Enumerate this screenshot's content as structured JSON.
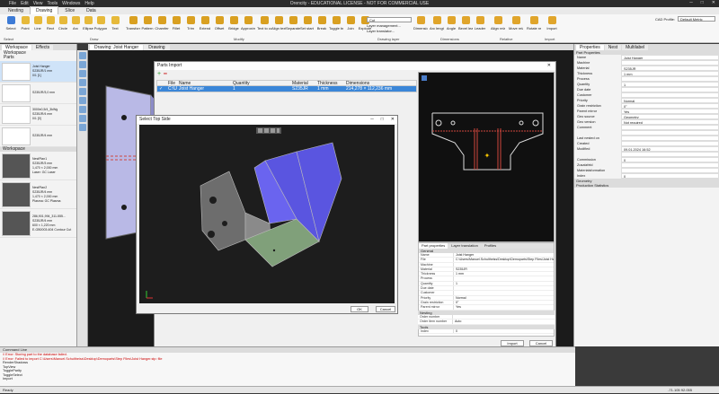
{
  "titlebar": {
    "title": "Orencity - EDUCATIONAL LICENSE - NOT FOR COMMERCIAL USE",
    "menu": [
      "File",
      "Edit",
      "View",
      "Tools",
      "Windows",
      "Help"
    ]
  },
  "ribbon_tabs": [
    "Nesting",
    "Drawing",
    "Slice",
    "Data"
  ],
  "ribbon": {
    "buttons": [
      {
        "label": "Select",
        "color": "#3d7bd6"
      },
      {
        "label": "Point",
        "color": "#e6b93a"
      },
      {
        "label": "Line",
        "color": "#e6b93a"
      },
      {
        "label": "Rect",
        "color": "#e6b93a"
      },
      {
        "label": "Circle",
        "color": "#e6b93a"
      },
      {
        "label": "Arc",
        "color": "#e6b93a"
      },
      {
        "label": "Ellipse",
        "color": "#e6b93a"
      },
      {
        "label": "Polygon",
        "color": "#e6b93a"
      },
      {
        "label": "Text",
        "color": "#e6b93a"
      },
      {
        "label": "Transform",
        "color": "#d9a021"
      },
      {
        "label": "Pattern",
        "color": "#d9a021"
      },
      {
        "label": "Chamfer",
        "color": "#d9a021"
      },
      {
        "label": "Fillet",
        "color": "#d9a021"
      },
      {
        "label": "Trim",
        "color": "#d9a021"
      },
      {
        "label": "Extend",
        "color": "#d9a021"
      },
      {
        "label": "Offset",
        "color": "#d9a021"
      },
      {
        "label": "Bridge",
        "color": "#d9a021"
      },
      {
        "label": "Approximate",
        "color": "#d9a021"
      },
      {
        "label": "Text to contours",
        "color": "#d9a021"
      },
      {
        "label": "Align text to circle",
        "color": "#d9a021"
      },
      {
        "label": "Separate parts",
        "color": "#d9a021"
      },
      {
        "label": "Set start point",
        "color": "#d9a021"
      },
      {
        "label": "Break",
        "color": "#d9a021"
      },
      {
        "label": "Toggle break",
        "color": "#d9a021"
      },
      {
        "label": "Join",
        "color": "#d9a021"
      },
      {
        "label": "Explode",
        "color": "#d9a021"
      },
      {
        "label": "Dimension",
        "color": "#e0a52b"
      },
      {
        "label": "Arc length",
        "color": "#e0a52b"
      },
      {
        "label": "Angle",
        "color": "#e0a52b"
      },
      {
        "label": "Bevel leader",
        "color": "#e0a52b"
      },
      {
        "label": "Leader",
        "color": "#e0a52b"
      },
      {
        "label": "Align relative CS",
        "color": "#e0a52b"
      },
      {
        "label": "Move relative CS",
        "color": "#e0a52b"
      },
      {
        "label": "Rotate relative CS",
        "color": "#e0a52b"
      },
      {
        "label": "Import",
        "color": "#e0a52b"
      }
    ],
    "groups": [
      "Select",
      "Draw",
      "Modify",
      "Drawing layer",
      "Dimensions",
      "Relative",
      "Import"
    ],
    "layer": {
      "cut": "Cut",
      "layer_management": "Layer management...",
      "layer_translator": "Layer translator..."
    },
    "cad_profile_label": "CAD Profile:",
    "cad_profile_value": "Default Metric"
  },
  "left_panel": {
    "tabs": [
      "Workspace",
      "Effects"
    ],
    "tree": [
      "Workspace",
      "Parts"
    ],
    "parts": [
      {
        "lines": [
          "Joist Hanger",
          "S235JR/1 mm",
          "0/1 [1]"
        ]
      },
      {
        "lines": [
          "S235JR/3,0 mm"
        ]
      },
      {
        "lines": [
          "3000x0,5/4_3kWg",
          "S235JR/4 mm",
          "0/1 [0]"
        ]
      },
      {
        "lines": [
          "S235JR/4 mm"
        ]
      },
      {
        "lines": [
          "Part3",
          "S235JR/4 mm",
          "0/1 [0]"
        ]
      },
      {
        "lines": [
          "Part4",
          "S235JR/4 mm",
          "Laser: GC Laser"
        ]
      },
      {
        "lines": [
          "Part5",
          "S235JR/4 mm"
        ]
      }
    ],
    "nests_header": "Workspace",
    "nests": [
      {
        "lines": [
          "NestPlan1",
          "S235JR/3 mm",
          "1,470 × 2,000 mm",
          "Laser: GC Laser"
        ]
      },
      {
        "lines": [
          "NestPlan2",
          "S235JR/4 mm",
          "1,470 × 2,000 mm",
          "Plasma: GC Plasma"
        ]
      },
      {
        "lines": [
          "286,901,994_311-555...",
          "S235JR/4 mm",
          "600 × 1,220 mm",
          "E-GB0003-604 Contour Cut"
        ]
      }
    ]
  },
  "doc_tabs": [
    "Drawing: Joist Hanger",
    "Drawing"
  ],
  "part_import": {
    "title": "Parts Import",
    "columns": [
      "File",
      "Name",
      "Quantity",
      "Material",
      "Thickness",
      "Dimensions"
    ],
    "row": [
      "C:\\Users\\Manuel.Schultheiss\\Desktop\\Demoparts\\Step files\\Joist Hanger.stp",
      "Joist Hanger",
      "1",
      "S235JR",
      "1 mm",
      "214,278 × 112,236 mm"
    ],
    "tabs": [
      "Part properties",
      "Layer translation",
      "Profiles"
    ],
    "sections": {
      "general": "General",
      "nesting": "Nesting",
      "tools": "Tools"
    },
    "props": [
      [
        "Name",
        "Joist Hanger"
      ],
      [
        "File",
        "C:\\Users\\Manuel.Schultheiss\\Desktop\\Demoparts\\Step Files\\Joist Han"
      ],
      [
        "Machine",
        ""
      ],
      [
        "Material",
        "S235JR"
      ],
      [
        "Thickness",
        "1 mm"
      ],
      [
        "Process",
        ""
      ],
      [
        "Quantity",
        "1"
      ],
      [
        "Due date",
        ""
      ],
      [
        "Customer",
        ""
      ],
      [
        "Priority",
        "Normal"
      ],
      [
        "Grain restriction",
        "0°"
      ],
      [
        "Parent mirror",
        "Yes"
      ],
      [
        "Comment",
        ""
      ],
      [
        "Commission",
        "0"
      ],
      [
        "Zusatzfeld",
        ""
      ],
      [
        "Materialsformation",
        ""
      ],
      [
        "Index",
        "0"
      ]
    ],
    "nesting_props": [
      [
        "Order number",
        ""
      ],
      [
        "Order item number",
        "Auto"
      ]
    ],
    "import_label": "Import",
    "cancel_label": "Cancel"
  },
  "select_top": {
    "title": "Select Top Side",
    "ok_label": "OK",
    "cancel_label": "Cancel"
  },
  "properties": {
    "tabs": [
      "Properties",
      "Nest",
      "Multilabel"
    ],
    "section": "Part Properties",
    "rows": [
      [
        "Name",
        "Joist Hanger"
      ],
      [
        "Machine",
        ""
      ],
      [
        "Material",
        "S235JR"
      ],
      [
        "Thickness",
        "1 mm"
      ],
      [
        "Process",
        ""
      ],
      [
        "Quantity",
        "1"
      ],
      [
        "Due date",
        ""
      ],
      [
        "Customer",
        ""
      ],
      [
        "Priority",
        "Normal"
      ],
      [
        "Grain restriction",
        "0°"
      ],
      [
        "Parent mirror",
        "Yes"
      ],
      [
        "Geo source",
        "Geometry"
      ],
      [
        "Geo version",
        "Not required"
      ],
      [
        "Comment",
        ""
      ],
      [
        "",
        ""
      ],
      [
        "Last nested on",
        ""
      ],
      [
        "Created",
        ""
      ],
      [
        "Modified",
        "09.01.2024 16:52"
      ],
      [
        "",
        ""
      ],
      [
        "Commission",
        "0"
      ],
      [
        "Zusatzfeld",
        ""
      ],
      [
        "Materialsformation",
        ""
      ],
      [
        "Index",
        "0"
      ]
    ],
    "sections2": [
      "Geometry",
      "Production Statistics"
    ]
  },
  "cmdline": {
    "title": "Command Line",
    "lines": [
      {
        "t": "// Error: Storing part to the database failed.",
        "c": "err"
      },
      {
        "t": "// Error: Failed to import C:\\Users\\Manuel.Schultheiss\\Desktop\\Demoparts\\Step Files\\Joist Hanger.stp: file",
        "c": "err"
      },
      {
        "t": "RenderShadows",
        "c": ""
      },
      {
        "t": "TopView",
        "c": ""
      },
      {
        "t": "ToggleParity",
        "c": ""
      },
      {
        "t": "ToggleSelect",
        "c": ""
      },
      {
        "t": "Import",
        "c": ""
      }
    ]
  },
  "status": {
    "left": "Ready",
    "coord": "-71.105  92.055"
  }
}
